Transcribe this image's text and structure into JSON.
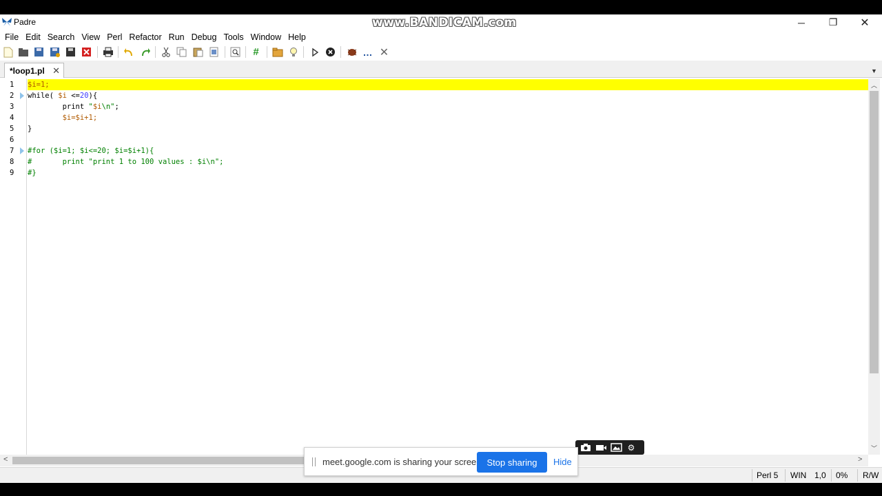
{
  "window": {
    "app_title": "Padre",
    "watermark": "www.BANDICAM.com",
    "min_glyph": "─",
    "max_glyph": "❐",
    "close_glyph": "✕"
  },
  "menu": [
    "File",
    "Edit",
    "Search",
    "View",
    "Perl",
    "Refactor",
    "Run",
    "Debug",
    "Tools",
    "Window",
    "Help"
  ],
  "toolbar_icons": [
    "new-file-icon",
    "open-icon",
    "save-icon",
    "save-as-icon",
    "save-all-icon",
    "close-file-icon",
    "print-icon",
    "undo-icon",
    "redo-icon",
    "cut-icon",
    "copy-icon",
    "paste-icon",
    "select-all-icon",
    "find-icon",
    "comment-icon",
    "open-folder-icon",
    "lightbulb-icon",
    "run-icon",
    "stop-icon",
    "debug-icon",
    "more-icon",
    "close-icon"
  ],
  "tab": {
    "label": "*loop1.pl",
    "close_glyph": "✕"
  },
  "editor": {
    "line_numbers": [
      "1",
      "2",
      "3",
      "4",
      "5",
      "6",
      "7",
      "8",
      "9"
    ],
    "lines": {
      "l1": "$i=1;",
      "l2_kw": "while(",
      "l2_var": " $i",
      "l2_op": " <=",
      "l2_num": "20",
      "l2_end": "){",
      "l3_kw": "        print ",
      "l3_str1": "\"",
      "l3_var": "$i",
      "l3_str2": "\\n\"",
      "l3_end": ";",
      "l4": "        $i=$i+1;",
      "l5": "}",
      "l6": "",
      "l7": "#for ($i=1; $i<=20; $i=$i+1){",
      "l8": "#       print \"print 1 to 100 values : $i\\n\";",
      "l9": "#}"
    }
  },
  "statusbar": {
    "language": "Perl 5",
    "newline": "WIN",
    "position": "1,0",
    "percent": "0%",
    "mode": "R/W"
  },
  "share_banner": {
    "text": "meet.google.com is sharing your screen.",
    "stop_label": "Stop sharing",
    "hide_label": "Hide"
  },
  "bandicam_widget": [
    "camera-icon",
    "video-icon",
    "image-icon",
    "settings-icon"
  ]
}
